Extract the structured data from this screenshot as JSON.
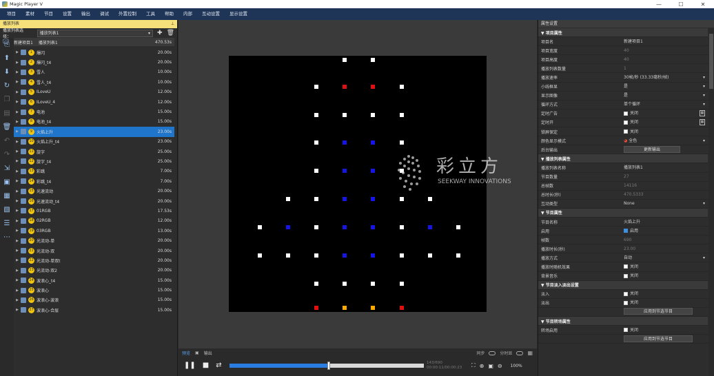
{
  "window": {
    "title": "Magic Player V",
    "min": "—",
    "max": "☐",
    "close": "✕"
  },
  "menu": [
    "项目",
    "素材",
    "节目",
    "设置",
    "输出",
    "调试",
    "外置控制",
    "工具",
    "帮助",
    "内部",
    "互动设置",
    "显示设置"
  ],
  "left_panel": {
    "title": "播放列表",
    "pin": "⊥",
    "select_label": "播放列表选择：",
    "select_value": "播放列表1",
    "project": {
      "name": "新建项目1",
      "list": "播放列表1",
      "duration": "470.53s"
    },
    "items": [
      {
        "num": "1",
        "name": "爆闪",
        "dur": "20.00s"
      },
      {
        "num": "2",
        "name": "爆闪_t4",
        "dur": "20.00s"
      },
      {
        "num": "3",
        "name": "雪人",
        "dur": "10.00s"
      },
      {
        "num": "4",
        "name": "雪人_t4",
        "dur": "10.00s"
      },
      {
        "num": "5",
        "name": "ILoveU",
        "dur": "12.00s"
      },
      {
        "num": "6",
        "name": "ILoveU_4",
        "dur": "12.00s"
      },
      {
        "num": "7",
        "name": "电池",
        "dur": "15.00s"
      },
      {
        "num": "8",
        "name": "电池_t4",
        "dur": "15.00s"
      },
      {
        "num": "9",
        "name": "火焰上升",
        "dur": "23.00s"
      },
      {
        "num": "10",
        "name": "火焰上升_t4",
        "dur": "23.00s"
      },
      {
        "num": "11",
        "name": "旋字",
        "dur": "25.00s"
      },
      {
        "num": "12",
        "name": "旋字_t4",
        "dur": "25.00s"
      },
      {
        "num": "13",
        "name": "彩跳",
        "dur": "7.00s"
      },
      {
        "num": "14",
        "name": "彩跳_t4",
        "dur": "7.00s"
      },
      {
        "num": "15",
        "name": "光速流动",
        "dur": "20.00s"
      },
      {
        "num": "16",
        "name": "光速流动_t4",
        "dur": "20.00s"
      },
      {
        "num": "17",
        "name": "01RGB",
        "dur": "17.53s"
      },
      {
        "num": "18",
        "name": "02RGB",
        "dur": "12.00s"
      },
      {
        "num": "19",
        "name": "03RGB",
        "dur": "13.00s"
      },
      {
        "num": "20",
        "name": "光流动-单",
        "dur": "20.00s"
      },
      {
        "num": "21",
        "name": "光流动-双",
        "dur": "20.00s"
      },
      {
        "num": "22",
        "name": "光流动-单双t",
        "dur": "20.00s"
      },
      {
        "num": "23",
        "name": "光流动-双2",
        "dur": "20.00s"
      },
      {
        "num": "24",
        "name": "波浪心_t4",
        "dur": "15.00s"
      },
      {
        "num": "25",
        "name": "波浪心",
        "dur": "15.00s"
      },
      {
        "num": "26",
        "name": "波浪心-波浪",
        "dur": "15.00s"
      },
      {
        "num": "27",
        "name": "波浪心-合层",
        "dur": "15.00s"
      }
    ],
    "selected_index": 8
  },
  "stage": {
    "watermark_cn": "彩立方",
    "watermark_en": "SEEKWAY INNOVATIONS",
    "colors": {
      "w": "#ffffff",
      "r": "#e01010",
      "b": "#1515e8",
      "o": "#ffaa00"
    },
    "rows": [
      {
        "y": 0.015,
        "dots": [
          [
            0.45,
            "w"
          ],
          [
            0.56,
            "w"
          ]
        ]
      },
      {
        "y": 0.12,
        "dots": [
          [
            0.34,
            "w"
          ],
          [
            0.45,
            "r"
          ],
          [
            0.56,
            "r"
          ],
          [
            0.67,
            "w"
          ]
        ]
      },
      {
        "y": 0.23,
        "dots": [
          [
            0.34,
            "w"
          ],
          [
            0.45,
            "w"
          ],
          [
            0.56,
            "w"
          ],
          [
            0.67,
            "w"
          ]
        ]
      },
      {
        "y": 0.34,
        "dots": [
          [
            0.34,
            "w"
          ],
          [
            0.45,
            "b"
          ],
          [
            0.56,
            "b"
          ],
          [
            0.67,
            "w"
          ]
        ]
      },
      {
        "y": 0.45,
        "dots": [
          [
            0.34,
            "w"
          ],
          [
            0.45,
            "b"
          ],
          [
            0.56,
            "b"
          ],
          [
            0.67,
            "w"
          ]
        ]
      },
      {
        "y": 0.56,
        "dots": [
          [
            0.23,
            "w"
          ],
          [
            0.34,
            "w"
          ],
          [
            0.45,
            "b"
          ],
          [
            0.56,
            "b"
          ],
          [
            0.67,
            "w"
          ],
          [
            0.78,
            "w"
          ]
        ]
      },
      {
        "y": 0.67,
        "dots": [
          [
            0.12,
            "w"
          ],
          [
            0.23,
            "b"
          ],
          [
            0.34,
            "w"
          ],
          [
            0.45,
            "b"
          ],
          [
            0.56,
            "b"
          ],
          [
            0.67,
            "w"
          ],
          [
            0.78,
            "b"
          ],
          [
            0.89,
            "w"
          ]
        ]
      },
      {
        "y": 0.78,
        "dots": [
          [
            0.12,
            "w"
          ],
          [
            0.23,
            "w"
          ],
          [
            0.34,
            "w"
          ],
          [
            0.45,
            "b"
          ],
          [
            0.56,
            "b"
          ],
          [
            0.67,
            "w"
          ],
          [
            0.78,
            "w"
          ],
          [
            0.89,
            "w"
          ]
        ]
      },
      {
        "y": 0.89,
        "dots": [
          [
            0.34,
            "w"
          ],
          [
            0.45,
            "w"
          ],
          [
            0.56,
            "w"
          ],
          [
            0.67,
            "w"
          ]
        ]
      },
      {
        "y": 0.985,
        "dots": [
          [
            0.34,
            "r"
          ],
          [
            0.45,
            "o"
          ],
          [
            0.56,
            "o"
          ],
          [
            0.67,
            "r"
          ]
        ]
      }
    ]
  },
  "controls": {
    "tab_preview": "预览",
    "tab_output": "输出",
    "sync": "同步",
    "display": "分时显",
    "progress": 0.51,
    "frame": "143/690",
    "time": "00:00:11/00:00:23",
    "zoom": "100%"
  },
  "props": {
    "title": "属性设置",
    "rows": [
      {
        "type": "sec",
        "k": "▼ 项目属性"
      },
      {
        "k": "项目名",
        "v": "新建项目1"
      },
      {
        "k": "项目宽度",
        "v": "40",
        "ro": true
      },
      {
        "k": "项目高度",
        "v": "40",
        "ro": true
      },
      {
        "k": "播放列表数量",
        "v": "1",
        "ro": true
      },
      {
        "k": "播放速率",
        "v": "30帧/秒 (33.33毫秒/帧)",
        "dd": true
      },
      {
        "k": "小线框显",
        "v": "是",
        "dd": true
      },
      {
        "k": "显示图像",
        "v": "是",
        "dd": true
      },
      {
        "k": "循环方式",
        "v": "单个循环",
        "dd": true
      },
      {
        "k": "定时广告",
        "cb": false,
        "v": "关闭",
        "calc": true
      },
      {
        "k": "定时开",
        "cb": false,
        "v": "关闭",
        "calc": true
      },
      {
        "k": "锁屏保定",
        "cb": false,
        "v": "关闭"
      },
      {
        "k": "颜色显示模式",
        "v": "全色",
        "dd": true,
        "palette": true
      },
      {
        "k": "后台输出",
        "btn": "更新输出"
      },
      {
        "type": "sec",
        "k": "▼ 播放列表属性"
      },
      {
        "k": "播放列表名称",
        "v": "播放列表1"
      },
      {
        "k": "节目数量",
        "v": "27",
        "ro": true
      },
      {
        "k": "总帧数",
        "v": "14116",
        "ro": true
      },
      {
        "k": "总时长(秒)",
        "v": "470.5333",
        "ro": true
      },
      {
        "k": "互动类型",
        "v": "None",
        "dd": true
      },
      {
        "type": "sec",
        "k": "▼ 节目属性"
      },
      {
        "k": "节目名称",
        "v": "火焰上升"
      },
      {
        "k": "启用",
        "cb": true,
        "v": "启用"
      },
      {
        "k": "帧数",
        "v": "690",
        "ro": true
      },
      {
        "k": "播放时长(秒)",
        "v": "23.00",
        "ro": true
      },
      {
        "k": "播放方式",
        "v": "自动",
        "dd": true
      },
      {
        "k": "播放时随机效果",
        "cb": false,
        "v": "关闭"
      },
      {
        "k": "背景音乐",
        "cb": false,
        "v": "关闭"
      },
      {
        "type": "sec",
        "k": "▼ 节目淡入淡出设置"
      },
      {
        "k": "淡入",
        "cb": false,
        "v": "关闭"
      },
      {
        "k": "淡出",
        "cb": false,
        "v": "关闭"
      },
      {
        "k": "",
        "btn": "应用到节选节目"
      },
      {
        "type": "sec",
        "k": "▼ 节目转场属性"
      },
      {
        "k": "转场启用",
        "cb": false,
        "v": "关闭"
      },
      {
        "k": "",
        "btn": "应用到节选节目"
      }
    ]
  }
}
